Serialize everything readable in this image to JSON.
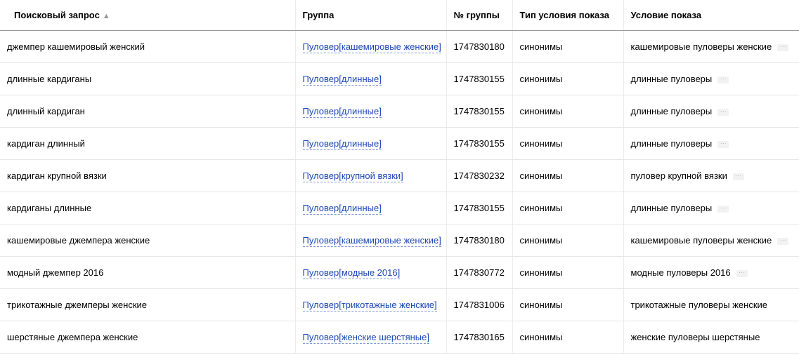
{
  "columns": {
    "query": "Поисковый запрос",
    "sort_indicator": "▲",
    "group": "Группа",
    "group_number": "№ группы",
    "condition_type": "Тип условия показа",
    "condition": "Условие показа"
  },
  "icons": {
    "more": "ellipsis-icon",
    "sort": "sort-ascending-icon"
  },
  "colors": {
    "link": "#1a47b8",
    "header_border": "#9a9a9a"
  },
  "rows": [
    {
      "query": "джемпер кашемировый женский",
      "group": "Пуловер[кашемировые женские]",
      "group_number": "1747830180",
      "condition_type": "синонимы",
      "condition": "кашемировые пуловеры женские",
      "has_more": true
    },
    {
      "query": "длинные кардиганы",
      "group": "Пуловер[длинные]",
      "group_number": "1747830155",
      "condition_type": "синонимы",
      "condition": "длинные пуловеры",
      "has_more": true
    },
    {
      "query": "длинный кардиган",
      "group": "Пуловер[длинные]",
      "group_number": "1747830155",
      "condition_type": "синонимы",
      "condition": "длинные пуловеры",
      "has_more": true
    },
    {
      "query": "кардиган длинный",
      "group": "Пуловер[длинные]",
      "group_number": "1747830155",
      "condition_type": "синонимы",
      "condition": "длинные пуловеры",
      "has_more": true
    },
    {
      "query": "кардиган крупной вязки",
      "group": "Пуловер[крупной вязки]",
      "group_number": "1747830232",
      "condition_type": "синонимы",
      "condition": "пуловер крупной вязки",
      "has_more": true
    },
    {
      "query": "кардиганы длинные",
      "group": "Пуловер[длинные]",
      "group_number": "1747830155",
      "condition_type": "синонимы",
      "condition": "длинные пуловеры",
      "has_more": true
    },
    {
      "query": "кашемировые джемпера женские",
      "group": "Пуловер[кашемировые женские]",
      "group_number": "1747830180",
      "condition_type": "синонимы",
      "condition": "кашемировые пуловеры женские",
      "has_more": true
    },
    {
      "query": "модный джемпер 2016",
      "group": "Пуловер[модные 2016]",
      "group_number": "1747830772",
      "condition_type": "синонимы",
      "condition": "модные пуловеры 2016",
      "has_more": true
    },
    {
      "query": "трикотажные джемперы женские",
      "group": "Пуловер[трикотажные женские]",
      "group_number": "1747831006",
      "condition_type": "синонимы",
      "condition": "трикотажные пуловеры женские",
      "has_more": false
    },
    {
      "query": "шерстяные джемпера женские",
      "group": "Пуловер[женские шерстяные]",
      "group_number": "1747830165",
      "condition_type": "синонимы",
      "condition": "женские пуловеры шерстяные",
      "has_more": false
    }
  ]
}
